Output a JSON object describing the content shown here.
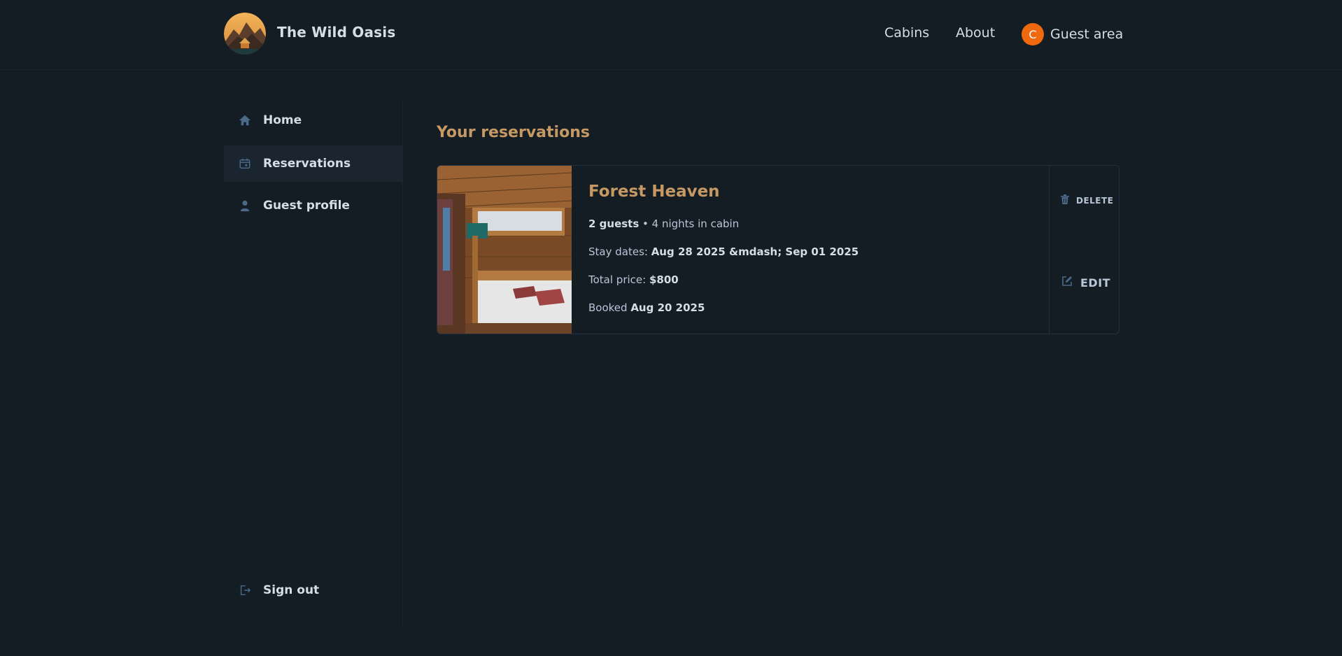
{
  "header": {
    "brand": "The Wild Oasis",
    "nav": {
      "cabins": "Cabins",
      "about": "About"
    },
    "guest_area": {
      "avatar_initial": "C",
      "label": "Guest area"
    }
  },
  "sidebar": {
    "items": [
      {
        "label": "Home",
        "icon": "home-icon"
      },
      {
        "label": "Reservations",
        "icon": "calendar-icon",
        "active": true
      },
      {
        "label": "Guest profile",
        "icon": "user-icon"
      }
    ],
    "sign_out": {
      "label": "Sign out",
      "icon": "sign-out-icon"
    }
  },
  "main": {
    "title": "Your reservations",
    "reservations": [
      {
        "cabin_name": "Forest Heaven",
        "guests": "2 guests",
        "nights": " • 4 nights in cabin",
        "stay_label": "Stay dates: ",
        "stay_dates": "Aug 28 2025 &mdash; Sep 01 2025",
        "price_label": "Total price: ",
        "price": "$800",
        "booked_label": "Booked ",
        "booked_date": "Aug 20 2025",
        "delete_label": "DELETE",
        "edit_label": "EDIT"
      }
    ]
  },
  "colors": {
    "background": "#141c24",
    "accent": "#c69963",
    "avatar": "#f0690f",
    "active_item": "#1b2530"
  }
}
